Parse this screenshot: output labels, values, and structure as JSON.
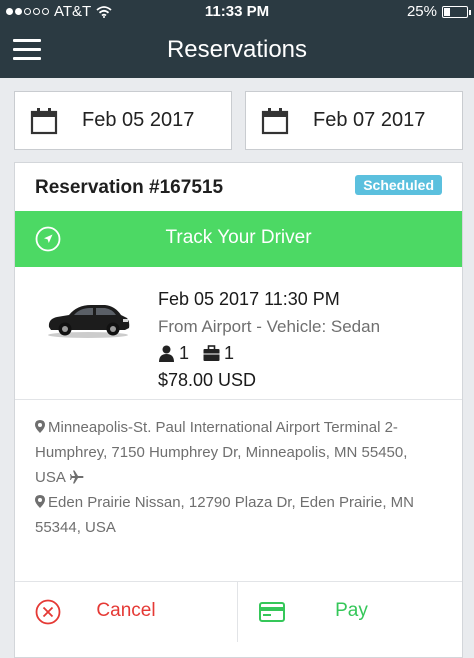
{
  "status_bar": {
    "carrier": "AT&T",
    "time": "11:33 PM",
    "battery": "25%",
    "battery_level": 0.25
  },
  "header": {
    "title": "Reservations"
  },
  "date_range": {
    "from": "Feb 05 2017",
    "to": "Feb 07 2017"
  },
  "reservation": {
    "number": "Reservation #167515",
    "status": "Scheduled",
    "track_label": "Track Your Driver",
    "datetime": "Feb 05 2017 11:30 PM",
    "trip_type": "From Airport - Vehicle: Sedan",
    "passengers": "1",
    "luggage": "1",
    "price": "$78.00 USD",
    "pickup_line1": "Minneapolis-St. Paul International Airport Terminal 2-",
    "pickup_line2": "Humphrey, 7150 Humphrey Dr, Minneapolis, MN 55450,",
    "pickup_line3": "USA",
    "dropoff_line1": "Eden Prairie Nissan, 12790 Plaza Dr, Eden Prairie, MN",
    "dropoff_line2": "55344, USA"
  },
  "actions": {
    "cancel_label": "Cancel",
    "pay_label": "Pay"
  },
  "colors": {
    "nav_bg": "#2b3a42",
    "track_green": "#4cd964",
    "badge_blue": "#5bc0de",
    "cancel_red": "#e53935",
    "pay_green": "#35c759"
  }
}
